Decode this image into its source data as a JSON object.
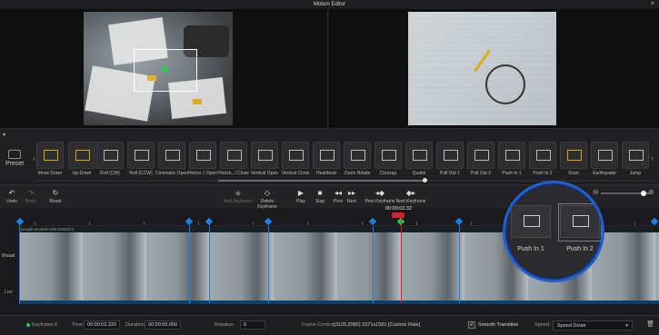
{
  "window": {
    "title": "Motion Editor",
    "close_glyph": "×"
  },
  "effects_bar": {
    "preset_label": "Preset",
    "prev_glyph": "‹",
    "next_glyph": "›",
    "items": [
      {
        "label": "Move Down"
      },
      {
        "label": "Up-Down"
      },
      {
        "label": "Roll (CW)"
      },
      {
        "label": "Roll (CCW)"
      },
      {
        "label": "Cinematic Open"
      },
      {
        "label": "Horizo..l Open"
      },
      {
        "label": "Horizo...l Close"
      },
      {
        "label": "Vertical Open"
      },
      {
        "label": "Vertical Close"
      },
      {
        "label": "Heartbeat"
      },
      {
        "label": "Zoom Rotate"
      },
      {
        "label": "Closeup"
      },
      {
        "label": "Quake"
      },
      {
        "label": "Pull Out 1"
      },
      {
        "label": "Pull Out 2"
      },
      {
        "label": "Push In 1"
      },
      {
        "label": "Push In 2"
      },
      {
        "label": "Scan"
      },
      {
        "label": "Earthquake"
      },
      {
        "label": "Jump"
      }
    ]
  },
  "toolbar": {
    "undo": "Undo",
    "redo": "Redo",
    "reset": "Reset",
    "add_keyframe": "Add Keyframe",
    "delete_keyframe": "Delete Keyframe",
    "play": "Play",
    "stop": "Stop",
    "prev": "Prev",
    "next": "Next",
    "prev_keyframe": "Prev Keyframe",
    "next_keyframe": "Next Keyframe",
    "zoom_minus": "⊖",
    "zoom_plus": "⊕"
  },
  "timeline": {
    "timecode": "00:00:02.32",
    "playhead_badge": "",
    "clip_name": "people-at-desk-with-5320474",
    "visual_label": "Visual",
    "list_label": "List"
  },
  "zoom_lens": {
    "items": [
      {
        "label": "Push In 1"
      },
      {
        "label": "Push In 2"
      }
    ]
  },
  "status": {
    "keyframe": "Keyframe 6",
    "time_label": "Time:",
    "time_value": "00:00:02.320",
    "duration_label": "Duration:",
    "duration_value": "00:00:00.000",
    "rotation_label": "Rotation:",
    "rotation_value": "0",
    "frame_control_label": "Frame Control:",
    "frame_control_value": "(3120,2080)  2371x1581  [Custom Rate]",
    "smooth_transition": "Smooth Transition",
    "speed_label": "Speed:",
    "speed_value": "Speed Down",
    "check_glyph": "✓",
    "caret_glyph": "▾",
    "trash_glyph": "🗑"
  },
  "colors": {
    "accent_blue": "#1b7fe3",
    "keyframe_green": "#1fd14c",
    "playhead_red": "#d31f2a",
    "gold_icon": "#d7a417"
  }
}
